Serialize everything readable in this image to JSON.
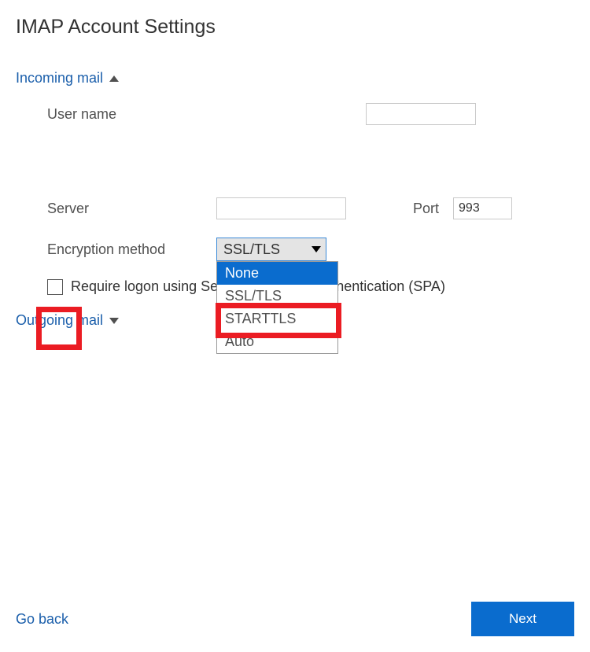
{
  "title": "IMAP Account Settings",
  "incoming": {
    "header": "Incoming mail",
    "expanded": true,
    "username_label": "User name",
    "username_value": "",
    "server_label": "Server",
    "server_value": "",
    "port_label": "Port",
    "port_value": "993",
    "encryption_label": "Encryption method",
    "encryption_selected": "SSL/TLS",
    "encryption_options": [
      "None",
      "SSL/TLS",
      "STARTTLS",
      "Auto"
    ],
    "encryption_highlighted_index": 0,
    "spa_label": "Require logon using Secure Password Authentication (SPA)",
    "spa_checked": false
  },
  "outgoing": {
    "header": "Outgoing mail",
    "expanded": false
  },
  "footer": {
    "go_back": "Go back",
    "next": "Next"
  },
  "annotations": {
    "red_highlight_checkbox": true,
    "red_highlight_option_none": true
  }
}
